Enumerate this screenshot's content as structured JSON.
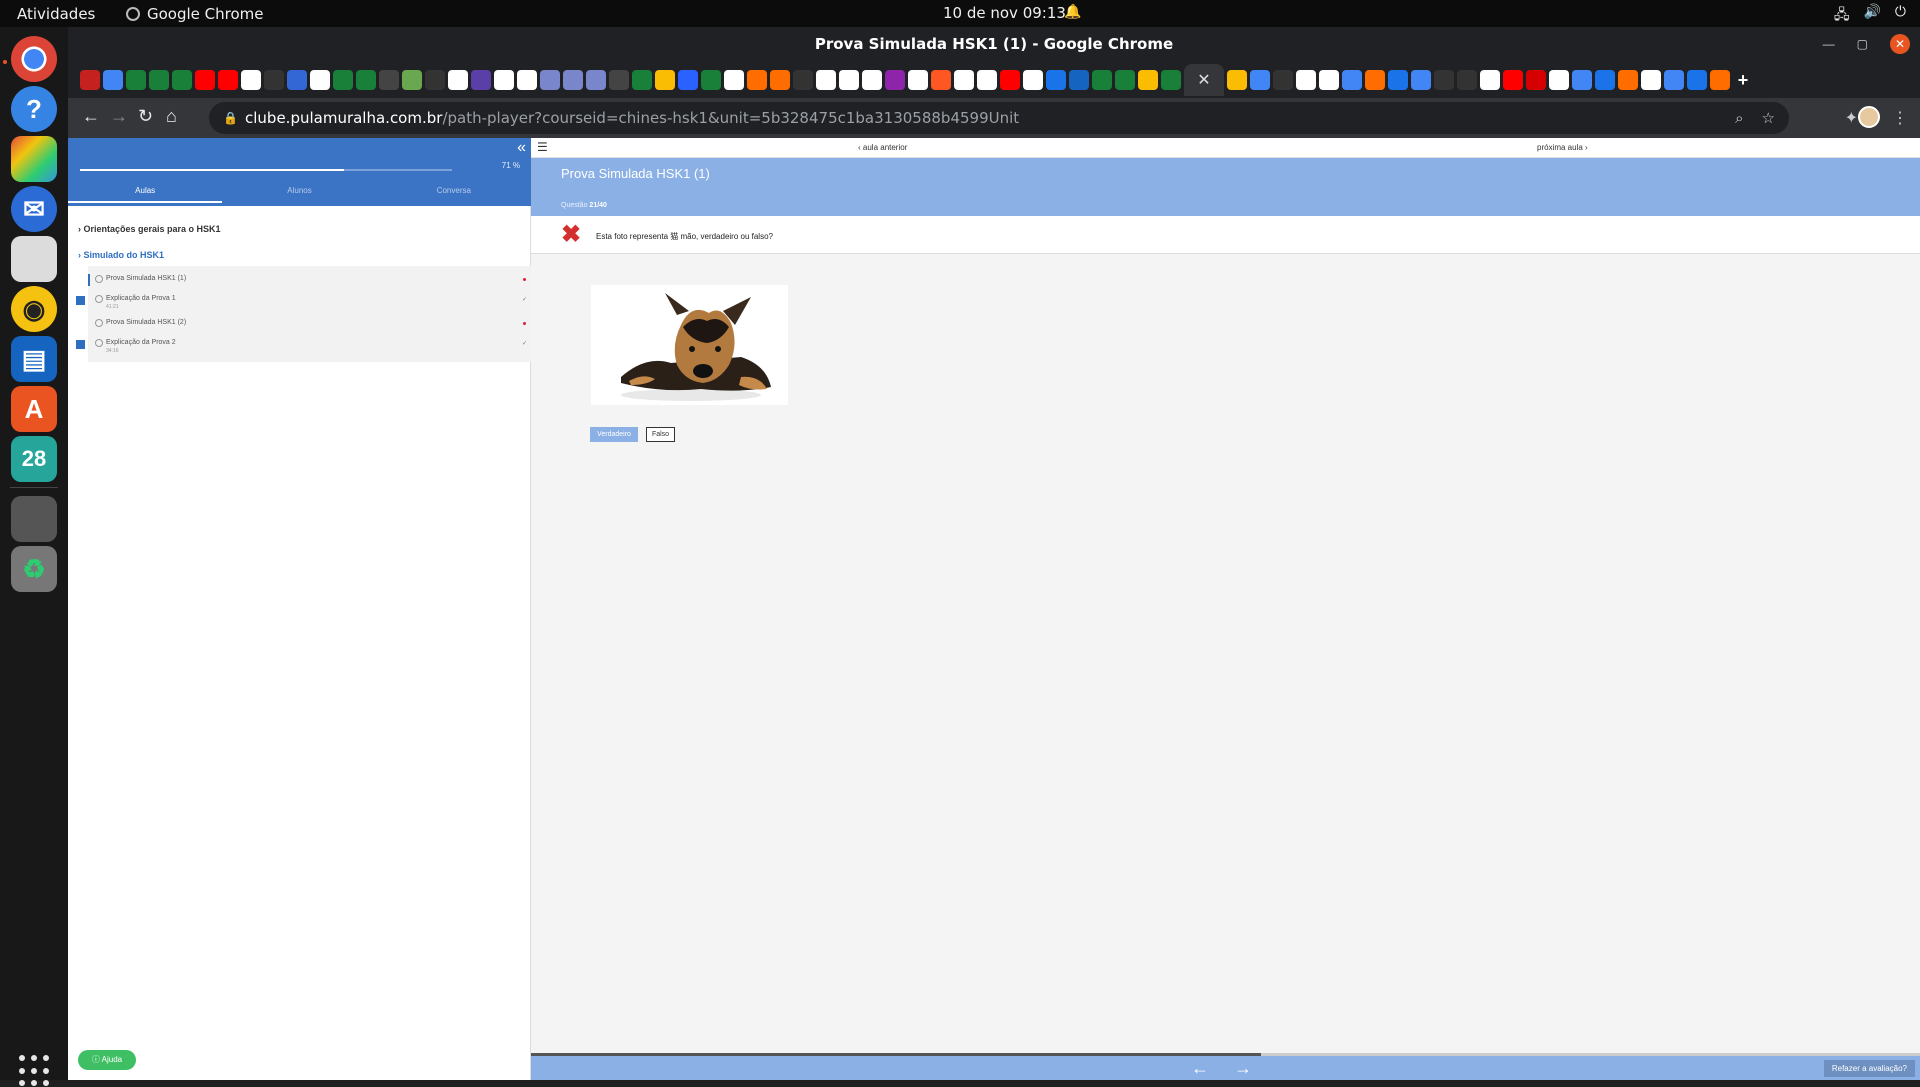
{
  "topbar": {
    "activities": "Atividades",
    "app_name": "Google Chrome",
    "clock": "10 de nov  09:13"
  },
  "window": {
    "title": "Prova Simulada HSK1 (1) - Google Chrome"
  },
  "address_bar": {
    "host": "clube.pulamuralha.com.br",
    "path": "/path-player?courseid=chines-hsk1&unit=5b328475c1ba3130588b4599Unit"
  },
  "sidebar": {
    "progress_percent": 71,
    "progress_label": "71 %",
    "tabs": [
      "Aulas",
      "Alunos",
      "Conversa"
    ],
    "active_tab": "Aulas",
    "sections": [
      {
        "title": "Orientações gerais para o HSK1"
      },
      {
        "title": "Simulado do HSK1"
      }
    ],
    "lessons": [
      {
        "title": "Prova Simulada HSK1 (1)",
        "duration": "",
        "completed": false,
        "current": true
      },
      {
        "title": "Explicação da Prova 1",
        "duration": "41:21",
        "completed": true,
        "current": false
      },
      {
        "title": "Prova Simulada HSK1 (2)",
        "duration": "",
        "completed": false,
        "current": false
      },
      {
        "title": "Explicação da Prova 2",
        "duration": "34:16",
        "completed": true,
        "current": false
      }
    ],
    "help_label": "Ajuda"
  },
  "player": {
    "prev_label": "aula anterior",
    "next_label": "próxima aula",
    "title": "Prova Simulada HSK1 (1)",
    "question_prefix": "Questão",
    "question_number": "21/40",
    "question_text": "Esta foto representa 猫 mão, verdadeiro ou falso?",
    "answer_true": "Verdadeiro",
    "answer_false": "Falso",
    "redo_label": "Refazer a avaliação?"
  },
  "colors": {
    "sidebar_header": "#3b74c4",
    "banner": "#8bb0e5",
    "wrong": "#d32f2f",
    "help": "#3fbf63"
  }
}
